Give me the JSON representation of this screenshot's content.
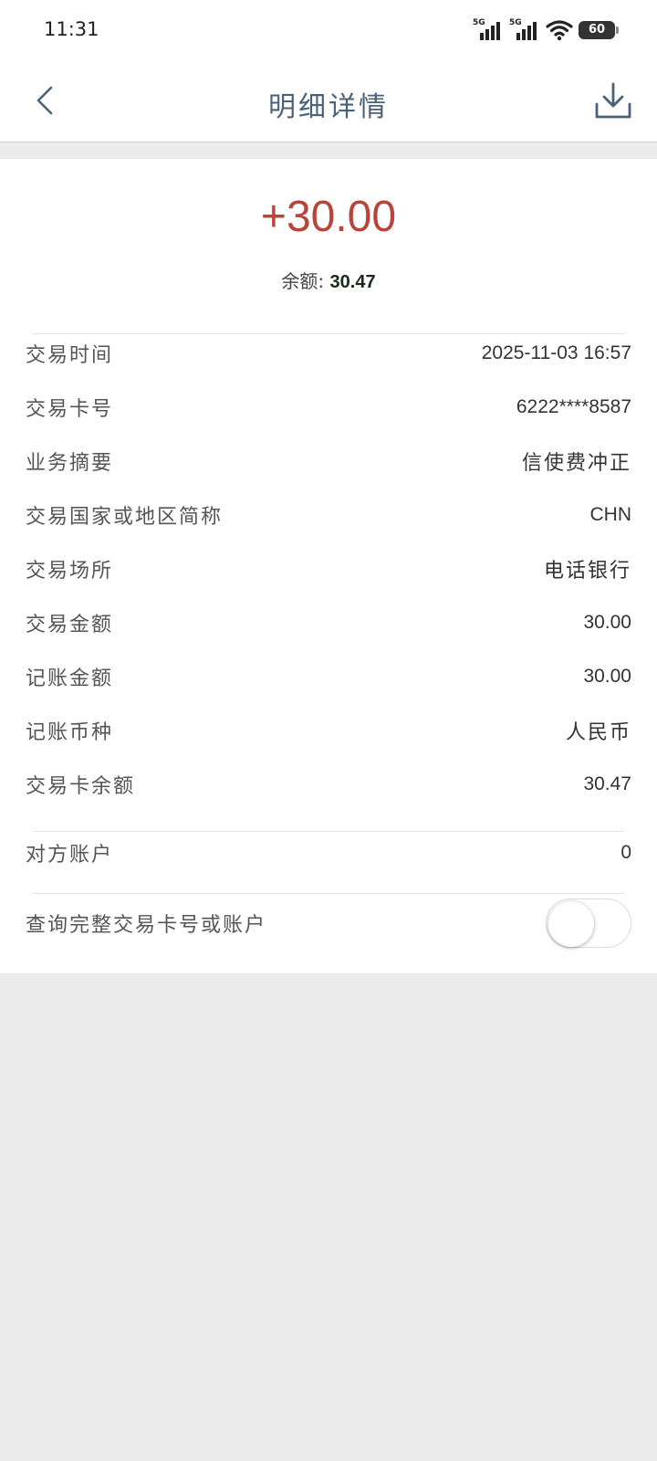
{
  "status_bar": {
    "time": "11:31",
    "signal1_label": "5G",
    "signal2_label": "5G",
    "battery": "60"
  },
  "navbar": {
    "title": "明细详情"
  },
  "summary": {
    "amount": "+30.00",
    "balance_label": "余额:",
    "balance_value": "30.47"
  },
  "details": [
    {
      "label": "交易时间",
      "value": "2025-11-03  16:57"
    },
    {
      "label": "交易卡号",
      "value": "6222****8587"
    },
    {
      "label": "业务摘要",
      "value": "信使费冲正"
    },
    {
      "label": "交易国家或地区简称",
      "value": "CHN"
    },
    {
      "label": "交易场所",
      "value": "电话银行"
    },
    {
      "label": "交易金额",
      "value": "30.00"
    },
    {
      "label": "记账金额",
      "value": "30.00"
    },
    {
      "label": "记账币种",
      "value": "人民币"
    },
    {
      "label": "交易卡余额",
      "value": "30.47"
    }
  ],
  "counterparty": {
    "label": "对方账户",
    "value": "0"
  },
  "full_card_query": {
    "label": "查询完整交易卡号或账户",
    "toggle_on": false
  },
  "colors": {
    "amount": "#b8443a",
    "title": "#4a6278",
    "background": "#ececec"
  }
}
